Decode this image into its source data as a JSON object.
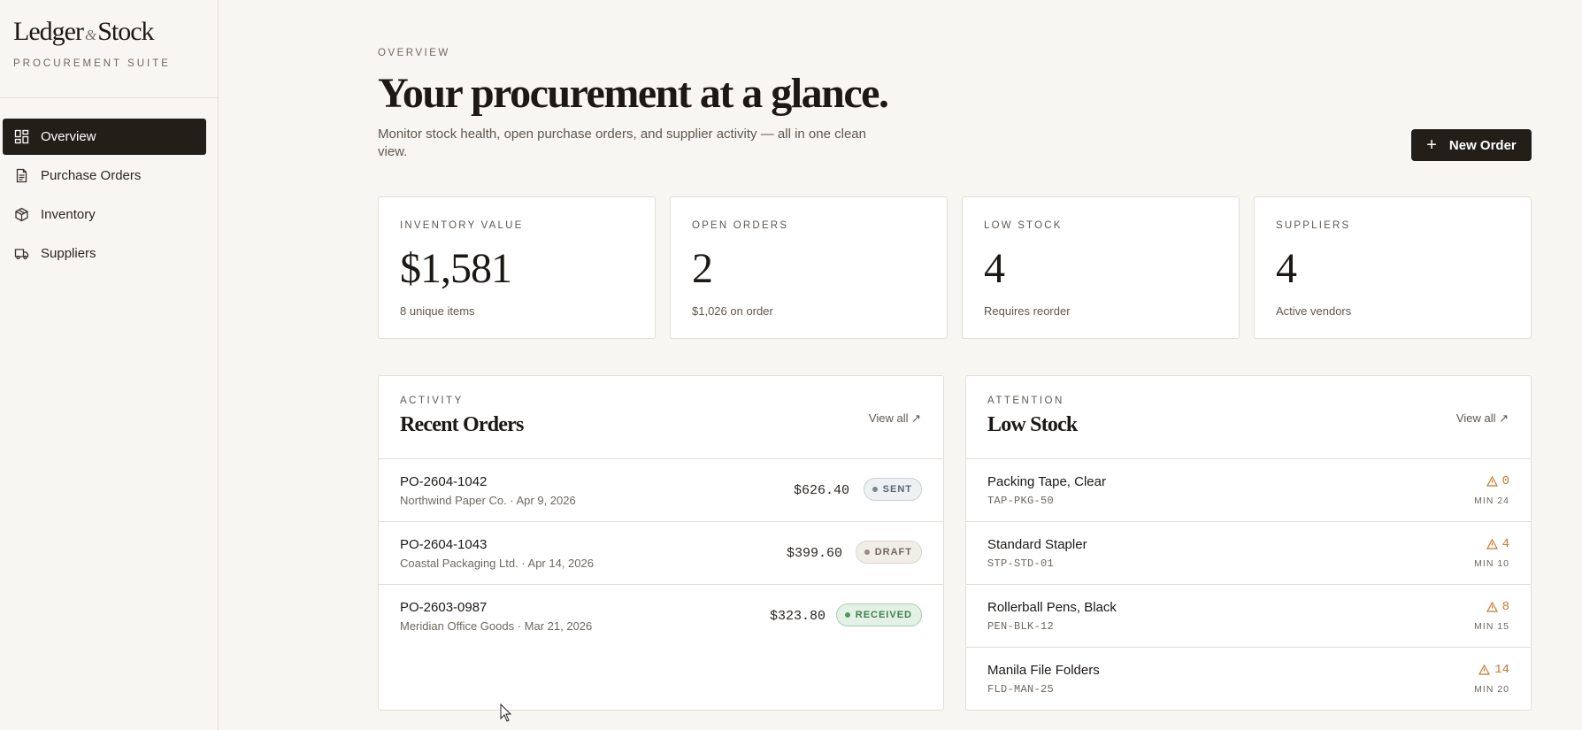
{
  "brand": {
    "name_left": "Ledger",
    "amp": "&",
    "name_right": "Stock",
    "subtitle": "PROCUREMENT SUITE"
  },
  "nav": [
    {
      "label": "Overview",
      "icon": "grid-icon",
      "active": true
    },
    {
      "label": "Purchase Orders",
      "icon": "document-icon",
      "active": false
    },
    {
      "label": "Inventory",
      "icon": "box-icon",
      "active": false
    },
    {
      "label": "Suppliers",
      "icon": "truck-icon",
      "active": false
    }
  ],
  "header": {
    "eyebrow": "OVERVIEW",
    "title": "Your procurement at a glance.",
    "subtitle": "Monitor stock health, open purchase orders, and supplier activity — all in one clean view.",
    "new_order_label": "New Order"
  },
  "stats": [
    {
      "label": "INVENTORY VALUE",
      "value": "$1,581",
      "note": "8 unique items"
    },
    {
      "label": "OPEN ORDERS",
      "value": "2",
      "note": "$1,026 on order"
    },
    {
      "label": "LOW STOCK",
      "value": "4",
      "note": "Requires reorder"
    },
    {
      "label": "SUPPLIERS",
      "value": "4",
      "note": "Active vendors"
    }
  ],
  "recent_orders": {
    "eyebrow": "ACTIVITY",
    "title": "Recent Orders",
    "view_all": "View all ↗",
    "rows": [
      {
        "id": "PO-2604-1042",
        "supplier_date": "Northwind Paper Co. · Apr 9, 2026",
        "amount": "$626.40",
        "status": "SENT"
      },
      {
        "id": "PO-2604-1043",
        "supplier_date": "Coastal Packaging Ltd. · Apr 14, 2026",
        "amount": "$399.60",
        "status": "DRAFT"
      },
      {
        "id": "PO-2603-0987",
        "supplier_date": "Meridian Office Goods · Mar 21, 2026",
        "amount": "$323.80",
        "status": "RECEIVED"
      }
    ]
  },
  "low_stock": {
    "eyebrow": "ATTENTION",
    "title": "Low Stock",
    "view_all": "View all ↗",
    "rows": [
      {
        "name": "Packing Tape, Clear",
        "sku": "TAP-PKG-50",
        "qty": "0",
        "min": "MIN 24"
      },
      {
        "name": "Standard Stapler",
        "sku": "STP-STD-01",
        "qty": "4",
        "min": "MIN 10"
      },
      {
        "name": "Rollerball Pens, Black",
        "sku": "PEN-BLK-12",
        "qty": "8",
        "min": "MIN 15"
      },
      {
        "name": "Manila File Folders",
        "sku": "FLD-MAN-25",
        "qty": "14",
        "min": "MIN 20"
      }
    ]
  },
  "colors": {
    "accent_dark": "#241e19",
    "warning": "#c8782a",
    "received_green": "#3f7f4d"
  }
}
